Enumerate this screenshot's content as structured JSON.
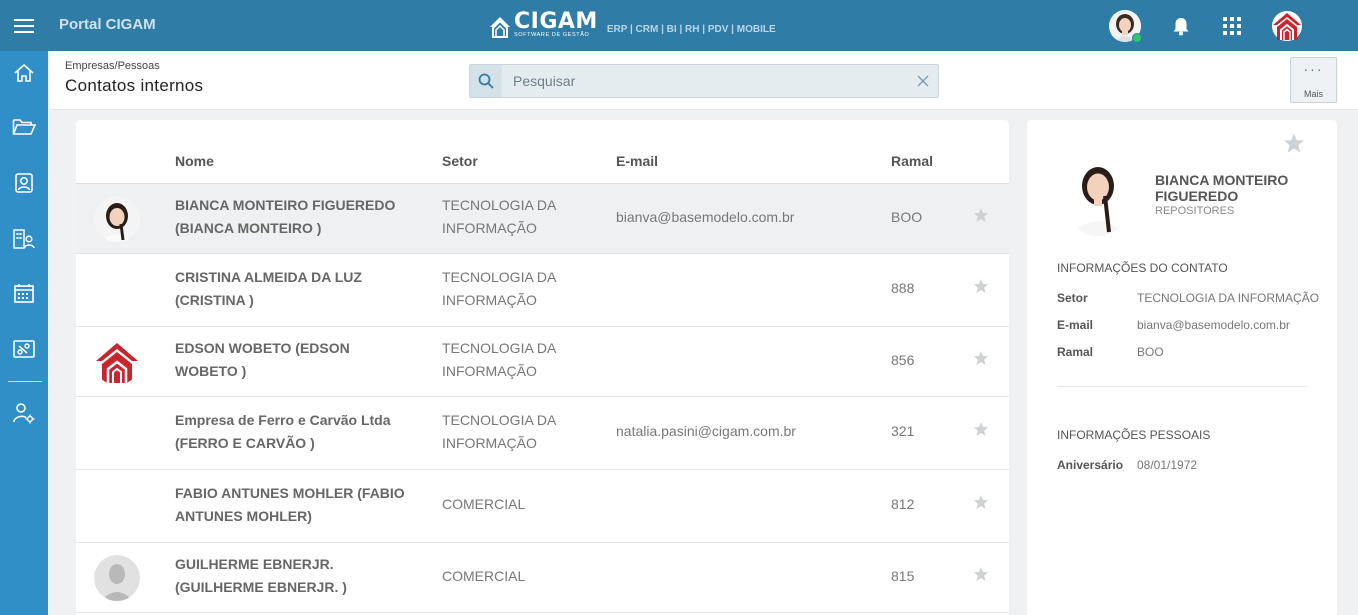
{
  "topbar": {
    "portal_title": "Portal CIGAM",
    "brand_name": "CIGAM",
    "brand_tagline": "SOFTWARE DE GESTÃO",
    "brand_modules": "ERP | CRM | BI | RH | PDV | MOBILE"
  },
  "sidebar": {
    "items": [
      {
        "name": "home-icon"
      },
      {
        "name": "folder-open-icon"
      },
      {
        "name": "contact-card-icon"
      },
      {
        "name": "company-contacts-icon"
      },
      {
        "name": "calendar-icon"
      },
      {
        "name": "ticket-icon"
      },
      {
        "name": "user-settings-icon"
      }
    ]
  },
  "header": {
    "breadcrumb": "Empresas/Pessoas",
    "title": "Contatos internos",
    "search_placeholder": "Pesquisar",
    "more_label": "Mais"
  },
  "table": {
    "columns": [
      "Nome",
      "Setor",
      "E-mail",
      "Ramal"
    ],
    "rows": [
      {
        "name": "BIANCA MONTEIRO FIGUEREDO (BIANCA MONTEIRO )",
        "setor": "TECNOLOGIA DA INFORMAÇÃO",
        "email": "bianva@basemodelo.com.br",
        "ramal": "BOO",
        "photo": "woman",
        "selected": true
      },
      {
        "name": "CRISTINA ALMEIDA DA LUZ (CRISTINA )",
        "setor": "TECNOLOGIA DA INFORMAÇÃO",
        "email": "",
        "ramal": "888",
        "photo": "none"
      },
      {
        "name": "EDSON WOBETO (EDSON WOBETO )",
        "setor": "TECNOLOGIA DA INFORMAÇÃO",
        "email": "",
        "ramal": "856",
        "photo": "house"
      },
      {
        "name": "Empresa de Ferro e Carvão Ltda (FERRO E CARVÃO )",
        "setor": "TECNOLOGIA DA INFORMAÇÃO",
        "email": "natalia.pasini@cigam.com.br",
        "ramal": "321",
        "photo": "none"
      },
      {
        "name": "FABIO ANTUNES MOHLER (FABIO ANTUNES MOHLER)",
        "setor": "COMERCIAL",
        "email": "",
        "ramal": "812",
        "photo": "none"
      },
      {
        "name": "GUILHERME EBNERJR. (GUILHERME EBNERJR. )",
        "setor": "COMERCIAL",
        "email": "",
        "ramal": "815",
        "photo": "placeholder"
      }
    ]
  },
  "detail": {
    "name": "BIANCA MONTEIRO FIGUEREDO",
    "role": "REPOSITORES",
    "contact_section": "INFORMAÇÕES DO CONTATO",
    "setor_label": "Setor",
    "setor_value": "TECNOLOGIA DA INFORMAÇÃO",
    "email_label": "E-mail",
    "email_value": "bianva@basemodelo.com.br",
    "ramal_label": "Ramal",
    "ramal_value": "BOO",
    "personal_section": "INFORMAÇÕES PESSOAIS",
    "birthday_label": "Aniversário",
    "birthday_value": "08/01/1972"
  },
  "colors": {
    "topbar": "#2f7ca6",
    "sidebar": "#2f8fc6",
    "brand_red": "#c8262c",
    "online": "#2fc56a"
  }
}
